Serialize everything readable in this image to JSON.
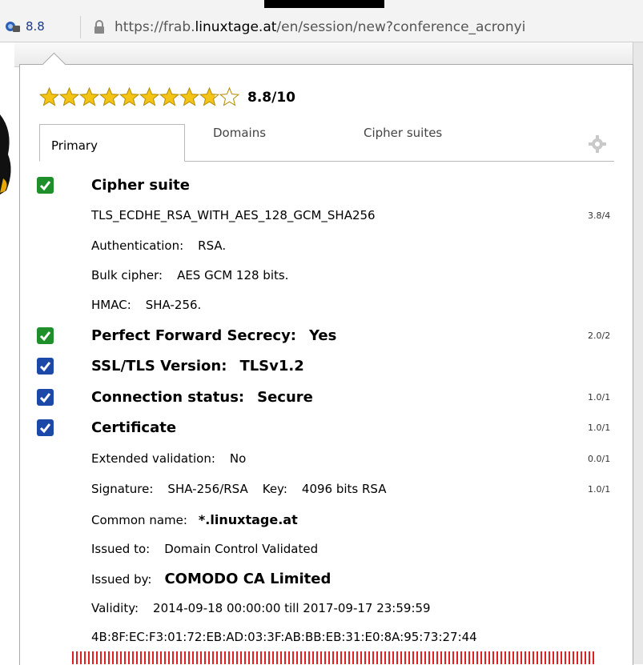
{
  "browser": {
    "extension_score": "8.8",
    "url_prefix": "https://frab.",
    "url_domain": "linuxtage.at",
    "url_suffix": "/en/session/new?conference_acronyi"
  },
  "popup": {
    "rating_text": "8.8/10",
    "rating_value": 8.8,
    "rating_max": 10,
    "tabs": [
      {
        "label": "Primary",
        "active": true
      },
      {
        "label": "Domains",
        "active": false
      },
      {
        "label": "Cipher suites",
        "active": false
      }
    ],
    "cipher_suite": {
      "heading": "Cipher suite",
      "name": "TLS_ECDHE_RSA_WITH_AES_128_GCM_SHA256",
      "score": "3.8/4",
      "auth_label": "Authentication:",
      "auth_value": "RSA.",
      "bulk_label": "Bulk cipher:",
      "bulk_value": "AES GCM 128 bits.",
      "hmac_label": "HMAC:",
      "hmac_value": "SHA-256."
    },
    "pfs": {
      "label": "Perfect Forward Secrecy:",
      "value": "Yes",
      "score": "2.0/2"
    },
    "tls_version": {
      "label": "SSL/TLS Version:",
      "value": "TLSv1.2"
    },
    "connection": {
      "label": "Connection status:",
      "value": "Secure",
      "score": "1.0/1"
    },
    "certificate": {
      "heading": "Certificate",
      "score": "1.0/1",
      "ev_label": "Extended validation:",
      "ev_value": "No",
      "ev_score": "0.0/1",
      "sig_label": "Signature:",
      "sig_value": "SHA-256/RSA",
      "key_label": "Key:",
      "key_value": "4096 bits RSA",
      "sig_score": "1.0/1",
      "cn_label": "Common name:",
      "cn_value": "*.linuxtage.at",
      "issued_to_label": "Issued to:",
      "issued_to_value": "Domain Control Validated",
      "issued_by_label": "Issued by:",
      "issued_by_value": "COMODO CA Limited",
      "validity_label": "Validity:",
      "validity_value": "2014-09-18 00:00:00 till 2017-09-17 23:59:59",
      "fingerprint": "4B:8F:EC:F3:01:72:EB:AD:03:3F:AB:BB:EB:31:E0:8A:95:73:27:44"
    }
  },
  "colors": {
    "check_green": "#1f8f2c",
    "check_blue": "#1c48a8",
    "star_gold": "#f3c316"
  },
  "icons": [
    "shield-icon",
    "padlock-icon",
    "star-icon",
    "gear-icon",
    "checkmark-icon"
  ]
}
